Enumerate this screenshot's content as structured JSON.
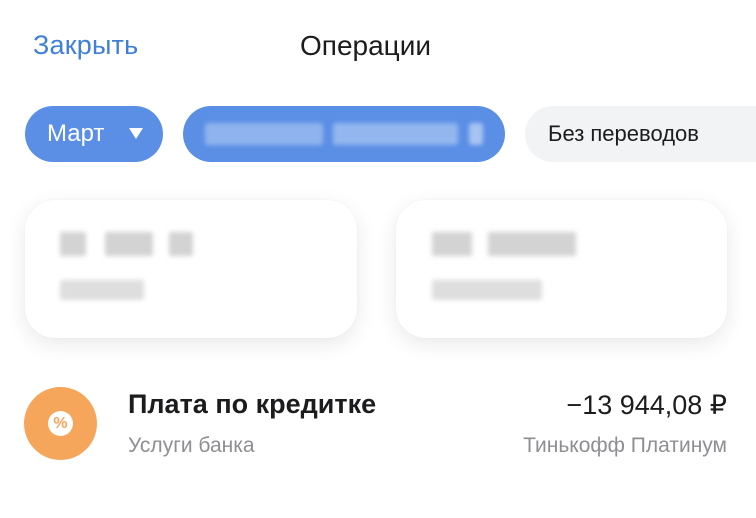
{
  "header": {
    "close_label": "Закрыть",
    "title": "Операции"
  },
  "filters": {
    "month_label": "Март",
    "account_label": "",
    "transfers_label": "Без переводов"
  },
  "operations": [
    {
      "icon": "percent-icon",
      "title": "Плата по кредитке",
      "category": "Услуги банка",
      "amount": "−13 944,08 ₽",
      "account": "Тинькофф Платинум"
    }
  ],
  "colors": {
    "accent": "#3f7fd9",
    "chip_active": "#5b8fe6",
    "chip_inactive": "#f2f3f5",
    "op_icon_bg": "#f5a65a",
    "secondary_text": "#8e8e93"
  }
}
